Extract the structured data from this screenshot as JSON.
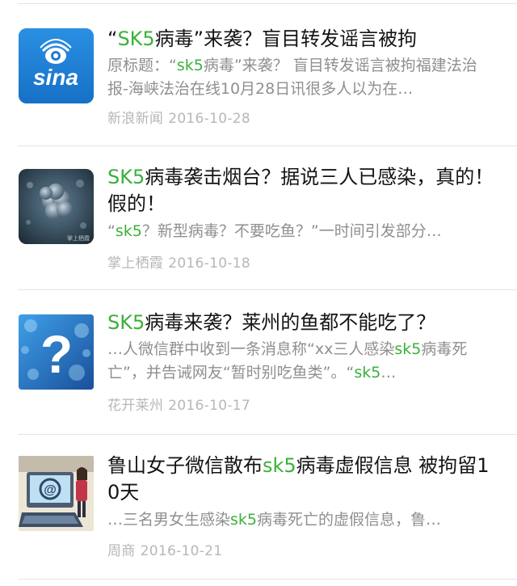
{
  "items": [
    {
      "thumb_icon": "sina-logo-icon",
      "thumb_text": "sina",
      "title": {
        "pre": "“",
        "hl": "SK5",
        "post": "病毒”来袭？盲目转发谣言被拘"
      },
      "summary": {
        "pre": "原标题：“",
        "hl": "sk5",
        "post": "病毒”来袭？ 盲目转发谣言被拘福建法治报-海峡法治在线10月28日讯很多人以为在…"
      },
      "source": "新浪新闻",
      "date": "2016-10-28"
    },
    {
      "thumb_icon": "virus-cell-icon",
      "thumb_watermark": "掌上栖霞",
      "title": {
        "pre": "",
        "hl": "SK5",
        "post": "病毒袭击烟台？据说三人已感染，真的！假的！"
      },
      "summary": {
        "pre": "“",
        "hl": "sk5",
        "post": "？新型病毒？不要吃鱼？”一时间引发部分…"
      },
      "source": "掌上栖霞",
      "date": "2016-10-18"
    },
    {
      "thumb_icon": "question-mark-icon",
      "title": {
        "pre": "",
        "hl": "SK5",
        "post": "病毒来袭？莱州的鱼都不能吃了？"
      },
      "summary": {
        "pre": "…人微信群中收到一条消息称“xx三人感染",
        "hl": "sk5",
        "post": "病毒死亡”，并告诫网友“暂时别吃鱼类”。“",
        "hl2": "sk5",
        "post2": "…"
      },
      "source": "花开莱州",
      "date": "2016-10-17"
    },
    {
      "thumb_icon": "cartoon-computer-icon",
      "title": {
        "pre": "鲁山女子微信散布",
        "hl": "sk5",
        "post": "病毒虚假信息 被拘留10天"
      },
      "summary": {
        "pre": "…三名男女生感染",
        "hl": "sk5",
        "post": "病毒死亡的虚假信息，鲁…"
      },
      "source": "周商",
      "date": "2016-10-21"
    }
  ]
}
